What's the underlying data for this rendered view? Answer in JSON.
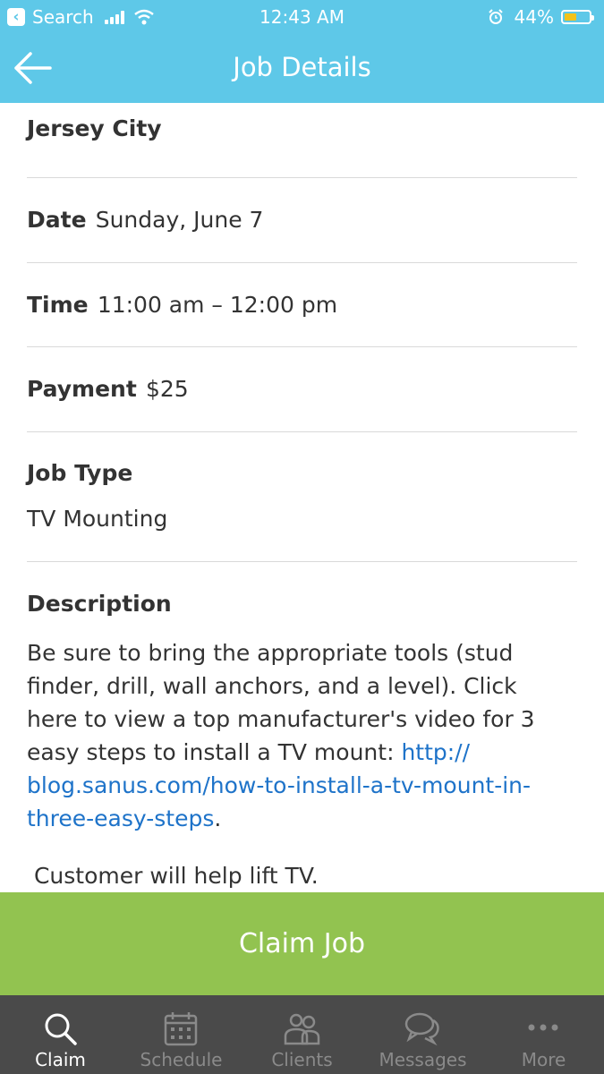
{
  "status_bar": {
    "back_app": "Search",
    "time": "12:43 AM",
    "battery": "44%",
    "battery_level": 0.44
  },
  "nav": {
    "title": "Job Details"
  },
  "job": {
    "location": "Jersey City",
    "date_label": "Date",
    "date_value": "Sunday, June 7",
    "time_label": "Time",
    "time_value": "11:00 am – 12:00 pm",
    "payment_label": "Payment",
    "payment_value": "$25",
    "job_type_label": "Job Type",
    "job_type_value": "TV Mounting",
    "description_label": "Description",
    "description_text": " Be sure to bring the appropriate tools (stud finder, drill, wall anchors, and a level). Click here to view a top manufacturer's video for 3 easy steps to install a TV mount: ",
    "description_link": "http://blog.sanus.com/how-to-install-a-tv-mount-in-three-easy-steps",
    "description_link_line1": "http://",
    "description_link_line2": "blog.sanus.com/how-to-install-a-tv-mount-in-",
    "description_link_line3": "three-easy-steps",
    "description_end": ".",
    "description_note": " Customer will help lift TV."
  },
  "claim_button": "Claim Job",
  "tabs": [
    {
      "label": "Claim",
      "icon": "search-icon",
      "active": true
    },
    {
      "label": "Schedule",
      "icon": "calendar-icon",
      "active": false
    },
    {
      "label": "Clients",
      "icon": "people-icon",
      "active": false
    },
    {
      "label": "Messages",
      "icon": "chat-bubbles-icon",
      "active": false
    },
    {
      "label": "More",
      "icon": "more-dots-icon",
      "active": false
    }
  ],
  "colors": {
    "header": "#5ec8e8",
    "claim_button": "#92c350",
    "tabbar": "#4a4a4a",
    "link": "#1e73c9"
  }
}
